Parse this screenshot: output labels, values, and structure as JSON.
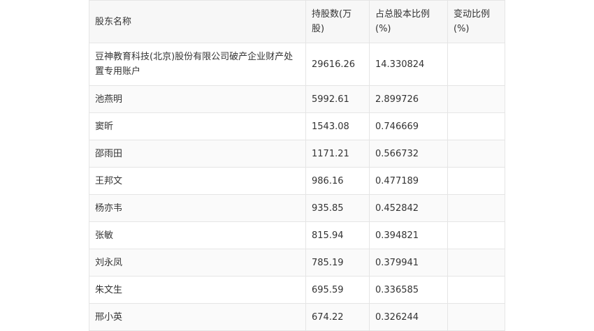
{
  "table": {
    "headers": [
      "股东名称",
      "持股数(万股)",
      "占总股本比例(%)",
      "变动比例(%)"
    ],
    "rows": [
      [
        "豆神教育科技(北京)股份有限公司破产企业财产处置专用账户",
        "29616.26",
        "14.330824",
        ""
      ],
      [
        "池燕明",
        "5992.61",
        "2.899726",
        ""
      ],
      [
        "窦昕",
        "1543.08",
        "0.746669",
        ""
      ],
      [
        "邵雨田",
        "1171.21",
        "0.566732",
        ""
      ],
      [
        "王邦文",
        "986.16",
        "0.477189",
        ""
      ],
      [
        "杨亦韦",
        "935.85",
        "0.452842",
        ""
      ],
      [
        "张敏",
        "815.94",
        "0.394821",
        ""
      ],
      [
        "刘永凤",
        "785.19",
        "0.379941",
        ""
      ],
      [
        "朱文生",
        "695.59",
        "0.336585",
        ""
      ],
      [
        "邢小英",
        "674.22",
        "0.326244",
        ""
      ]
    ]
  }
}
